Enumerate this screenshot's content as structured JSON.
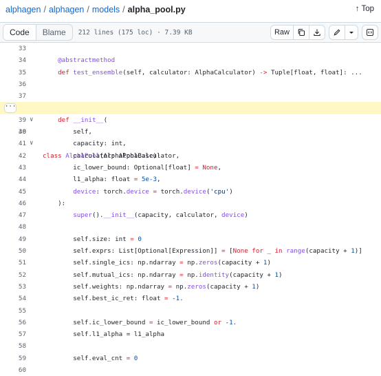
{
  "breadcrumb": {
    "repo": "alphagen",
    "dir1": "alphagen",
    "dir2": "models",
    "file": "alpha_pool.py",
    "sep": "/"
  },
  "top_link": "↑ Top",
  "toolbar": {
    "code_tab": "Code",
    "blame_tab": "Blame",
    "file_info": "212 lines (175 loc) · 7.39 KB",
    "raw_label": "Raw"
  },
  "code_lines": [
    {
      "n": "33",
      "fold": "",
      "t": ""
    },
    {
      "n": "34",
      "fold": "",
      "t": "    @abstractmethod"
    },
    {
      "n": "35",
      "fold": "",
      "t": "    def test_ensemble(self, calculator: AlphaCalculator) -> Tuple[float, float]: ..."
    },
    {
      "n": "36",
      "fold": "",
      "t": ""
    },
    {
      "n": "37",
      "fold": "",
      "t": ""
    },
    {
      "n": "38",
      "fold": "∨",
      "t": "class AlphaPool(AlphaPoolBase):"
    },
    {
      "n": "39",
      "fold": "∨",
      "t": "    def __init__("
    },
    {
      "n": "40",
      "fold": "",
      "t": "        self,"
    },
    {
      "n": "41",
      "fold": "",
      "t": "        capacity: int,"
    },
    {
      "n": "42",
      "fold": "",
      "t": "        calculator: AlphaCalculator,"
    },
    {
      "n": "43",
      "fold": "",
      "t": "        ic_lower_bound: Optional[float] = None,"
    },
    {
      "n": "44",
      "fold": "",
      "t": "        l1_alpha: float = 5e-3,"
    },
    {
      "n": "45",
      "fold": "",
      "t": "        device: torch.device = torch.device('cpu')"
    },
    {
      "n": "46",
      "fold": "",
      "t": "    ):"
    },
    {
      "n": "47",
      "fold": "",
      "t": "        super().__init__(capacity, calculator, device)"
    },
    {
      "n": "48",
      "fold": "",
      "t": ""
    },
    {
      "n": "49",
      "fold": "",
      "t": "        self.size: int = 0"
    },
    {
      "n": "50",
      "fold": "",
      "t": "        self.exprs: List[Optional[Expression]] = [None for _ in range(capacity + 1)]"
    },
    {
      "n": "51",
      "fold": "",
      "t": "        self.single_ics: np.ndarray = np.zeros(capacity + 1)"
    },
    {
      "n": "52",
      "fold": "",
      "t": "        self.mutual_ics: np.ndarray = np.identity(capacity + 1)"
    },
    {
      "n": "53",
      "fold": "",
      "t": "        self.weights: np.ndarray = np.zeros(capacity + 1)"
    },
    {
      "n": "54",
      "fold": "",
      "t": "        self.best_ic_ret: float = -1."
    },
    {
      "n": "55",
      "fold": "",
      "t": ""
    },
    {
      "n": "56",
      "fold": "",
      "t": "        self.ic_lower_bound = ic_lower_bound or -1."
    },
    {
      "n": "57",
      "fold": "",
      "t": "        self.l1_alpha = l1_alpha"
    },
    {
      "n": "58",
      "fold": "",
      "t": ""
    },
    {
      "n": "59",
      "fold": "",
      "t": "        self.eval_cnt = 0"
    },
    {
      "n": "60",
      "fold": "",
      "t": ""
    }
  ],
  "highlighted_line": "38",
  "colors": {
    "link": "#0969da",
    "keyword": "#cf222e",
    "function": "#8250df",
    "number": "#0550ae",
    "highlight": "#fff8c5"
  }
}
